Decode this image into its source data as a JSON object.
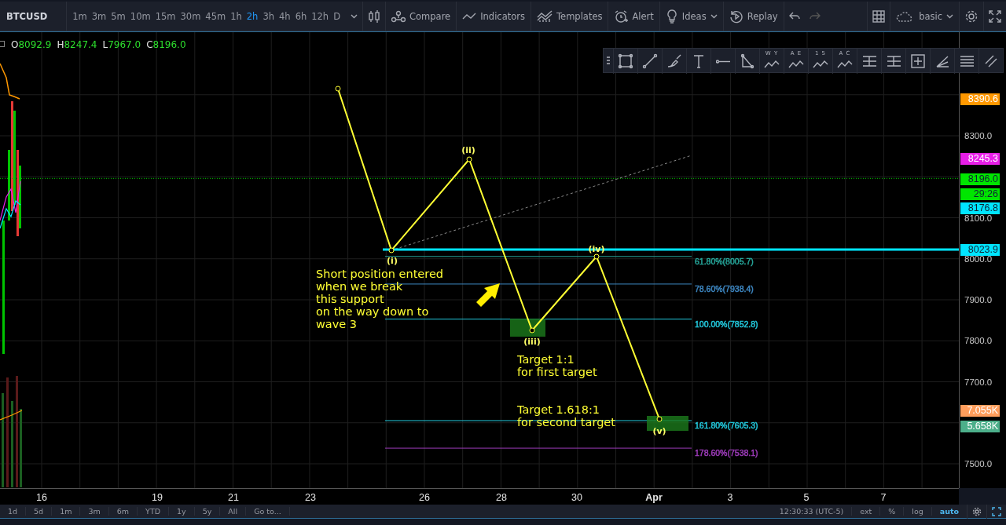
{
  "symbol": "BTCUSD",
  "intervals": [
    {
      "label": "1m",
      "selected": false
    },
    {
      "label": "3m",
      "selected": false
    },
    {
      "label": "5m",
      "selected": false
    },
    {
      "label": "10m",
      "selected": false
    },
    {
      "label": "15m",
      "selected": false
    },
    {
      "label": "30m",
      "selected": false
    },
    {
      "label": "45m",
      "selected": false
    },
    {
      "label": "1h",
      "selected": false
    },
    {
      "label": "2h",
      "selected": true
    },
    {
      "label": "3h",
      "selected": false
    },
    {
      "label": "4h",
      "selected": false
    },
    {
      "label": "6h",
      "selected": false
    },
    {
      "label": "12h",
      "selected": false
    },
    {
      "label": "D",
      "selected": false
    }
  ],
  "toolbar": [
    {
      "kind": "compare",
      "label": "Compare"
    },
    {
      "kind": "indicators",
      "label": "Indicators"
    },
    {
      "kind": "templates",
      "label": "Templates"
    },
    {
      "kind": "alert",
      "label": "Alert"
    },
    {
      "kind": "ideas",
      "label": "Ideas"
    },
    {
      "kind": "replay",
      "label": "Replay"
    }
  ],
  "layout_name": "basic",
  "ohlc": [
    {
      "key": "O",
      "value": "8092.9"
    },
    {
      "key": "H",
      "value": "8247.4"
    },
    {
      "key": "L",
      "value": "7967.0"
    },
    {
      "key": "C",
      "value": "8196.0"
    }
  ],
  "drawing_tools": [
    {
      "kind": "rect"
    },
    {
      "kind": "line"
    },
    {
      "kind": "brush"
    },
    {
      "kind": "text"
    },
    {
      "kind": "hline"
    },
    {
      "kind": "triangle"
    },
    {
      "kind": "wave",
      "label": "W Y"
    },
    {
      "kind": "wave",
      "label": "A E"
    },
    {
      "kind": "wave",
      "label": "1 5"
    },
    {
      "kind": "wave",
      "label": "A C"
    },
    {
      "kind": "fib"
    },
    {
      "kind": "fib"
    },
    {
      "kind": "gridbox"
    },
    {
      "kind": "fan"
    },
    {
      "kind": "lines"
    },
    {
      "kind": "channel"
    }
  ],
  "price_ticks": [
    "8300.0",
    "8100.0",
    "8000.0",
    "7900.0",
    "7800.0",
    "7700.0",
    "7500.0"
  ],
  "price_tags": [
    {
      "text": "8390.6",
      "color": "#ff9800"
    },
    {
      "text": "8245.3",
      "color": "#e81ee8"
    },
    {
      "text": "8196.0",
      "color": "#00e600"
    },
    {
      "text": "29:26",
      "color": "#00e600"
    },
    {
      "text": "8176.8",
      "color": "#00e5ff"
    },
    {
      "text": "8023.9",
      "color": "#00e5ff"
    },
    {
      "text": "7.055K",
      "color": "#ff9d5c"
    },
    {
      "text": "5.658K",
      "color": "#4caf8a"
    }
  ],
  "waves": [
    "(i)",
    "(ii)",
    "(iii)",
    "(iv)",
    "(v)"
  ],
  "fib_levels": [
    {
      "label": "61.80%(8005.7)",
      "color": "#26a69a"
    },
    {
      "label": "78.60%(7938.4)",
      "color": "#3d86c0"
    },
    {
      "label": "100.00%(7852.8)",
      "color": "#22c8dc"
    },
    {
      "label": "161.80%(7605.3)",
      "color": "#22c8dc"
    },
    {
      "label": "178.60%(7538.1)",
      "color": "#9c3bb8"
    }
  ],
  "notes": [
    [
      "Short position entered",
      "when we break",
      "this support",
      "on the way down to",
      "wave 3"
    ],
    [
      "Target 1:1",
      "for first target"
    ],
    [
      "Target 1.618:1",
      "for second target"
    ]
  ],
  "time_ticks": [
    "16",
    "19",
    "21",
    "23",
    "26",
    "28",
    "30",
    "Apr",
    "3",
    "5",
    "7"
  ],
  "ranges": [
    "1d",
    "5d",
    "1m",
    "3m",
    "6m",
    "YTD",
    "1y",
    "5y",
    "All",
    "Go to..."
  ],
  "clock": "12:30:33 (UTC-5)",
  "scale_toggles": [
    {
      "label": "ext",
      "on": false
    },
    {
      "label": "%",
      "on": false
    },
    {
      "label": "log",
      "on": false
    },
    {
      "label": "auto",
      "on": true
    }
  ]
}
